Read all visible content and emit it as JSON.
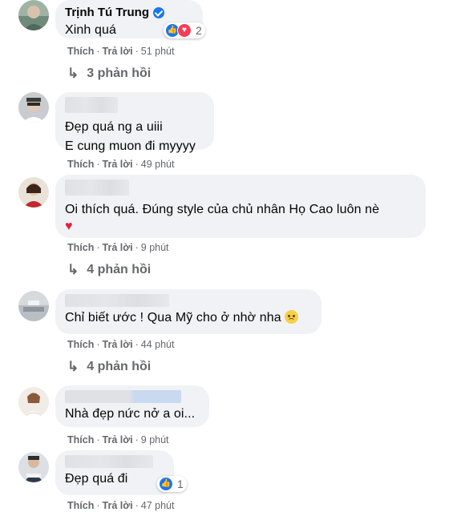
{
  "comments": [
    {
      "author": "Trịnh Tú Trung",
      "verified": true,
      "text": "Xinh quá",
      "reactions": {
        "count": "2",
        "types": [
          "like-icon",
          "love-icon"
        ]
      },
      "like_label": "Thích",
      "reply_label": "Trả lời",
      "time": "51 phút",
      "replies_label": "3 phản hồi"
    },
    {
      "author": "",
      "text": "Đẹp quá ng a uiii\nE cung muon đi myyyy",
      "like_label": "Thích",
      "reply_label": "Trả lời",
      "time": "49 phút"
    },
    {
      "author": "",
      "text": "Oi thích quá. Đúng style của chủ nhân Họ Cao luôn nè",
      "heart": "♥",
      "like_label": "Thích",
      "reply_label": "Trả lời",
      "time": "9 phút",
      "replies_label": "4 phản hồi"
    },
    {
      "author": "",
      "text": "Chỉ biết ước ! Qua Mỹ cho ở nhờ nha",
      "like_label": "Thích",
      "reply_label": "Trả lời",
      "time": "44 phút",
      "replies_label": "4 phản hồi"
    },
    {
      "author": "",
      "text": "Nhà đẹp nức nở a oi...",
      "like_label": "Thích",
      "reply_label": "Trả lời",
      "time": "9 phút"
    },
    {
      "author": "",
      "text": "Đẹp quá đi",
      "reactions": {
        "count": "1",
        "types": [
          "like-icon"
        ]
      },
      "like_label": "Thích",
      "reply_label": "Trả lời",
      "time": "47 phút"
    }
  ],
  "separator": "·",
  "colors": {
    "bubble": "#f0f2f5",
    "secondary_text": "#65676b",
    "like_blue": "#1877f2",
    "love_red": "#f33e58"
  }
}
